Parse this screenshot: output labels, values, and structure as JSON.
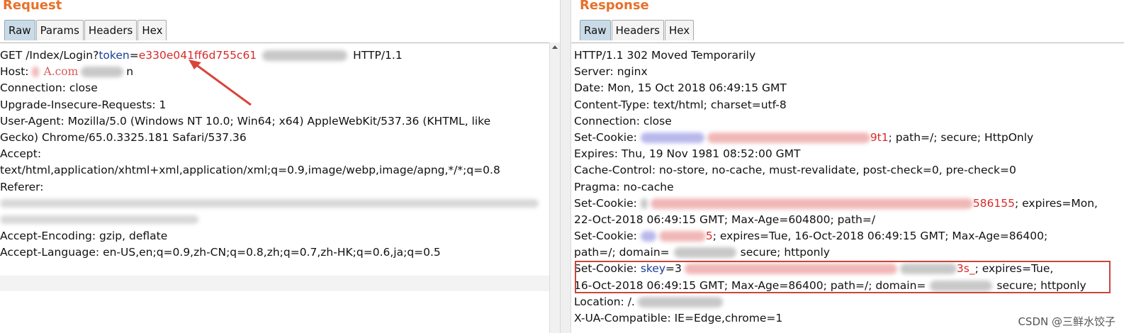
{
  "request": {
    "title": "Request",
    "tabs": [
      "Raw",
      "Params",
      "Headers",
      "Hex"
    ],
    "active_tab": "Raw",
    "lines": {
      "get_method": "GET /Index/Login?",
      "get_param": "token",
      "get_eq": "=",
      "get_value": "e330e041ff6d755c61",
      "get_tail": "HTTP/1.1",
      "host_label": "Host: ",
      "host_value": "A.com",
      "host_tail": "n",
      "connection": "Connection: close",
      "upgrade": "Upgrade-Insecure-Requests: 1",
      "ua1": "User-Agent: Mozilla/5.0 (Windows NT 10.0; Win64; x64) AppleWebKit/537.36 (KHTML, like",
      "ua2": "Gecko) Chrome/65.0.3325.181 Safari/537.36",
      "accept_label": "Accept:",
      "accept_value": "text/html,application/xhtml+xml,application/xml;q=0.9,image/webp,image/apng,*/*;q=0.8",
      "referer": "Referer:",
      "encoding": "Accept-Encoding: gzip, deflate",
      "language": "Accept-Language: en-US,en;q=0.9,zh-CN;q=0.8,zh;q=0.7,zh-HK;q=0.6,ja;q=0.5"
    }
  },
  "response": {
    "title": "Response",
    "tabs": [
      "Raw",
      "Headers",
      "Hex"
    ],
    "active_tab": "Raw",
    "lines": {
      "status": "HTTP/1.1 302 Moved Temporarily",
      "server": "Server: nginx",
      "date": "Date: Mon, 15 Oct 2018 06:49:15 GMT",
      "content_type": "Content-Type: text/html; charset=utf-8",
      "connection": "Connection: close",
      "cookie1_label": "Set-Cookie: ",
      "cookie1_frag": "9t1",
      "cookie1_tail": "; path=/; secure; HttpOnly",
      "expires": "Expires: Thu, 19 Nov 1981 08:52:00 GMT",
      "cache_control": "Cache-Control: no-store, no-cache, must-revalidate, post-check=0, pre-check=0",
      "pragma": "Pragma: no-cache",
      "cookie2_label": "Set-Cookie: ",
      "cookie2_frag": "586155",
      "cookie2_tail": "; expires=Mon,",
      "cookie2_line2": "22-Oct-2018 06:49:15 GMT; Max-Age=604800; path=/",
      "cookie3_label": "Set-Cookie: ",
      "cookie3_frag": "5",
      "cookie3_tail": "; expires=Tue, 16-Oct-2018 06:49:15 GMT; Max-Age=86400;",
      "cookie3_line2_a": "path=/; domain=",
      "cookie3_line2_b": "secure; httponly",
      "cookie4_label": "Set-Cookie: ",
      "cookie4_param": "skey",
      "cookie4_eq": "=3",
      "cookie4_frag": "3s_",
      "cookie4_tail": "; expires=Tue,",
      "cookie4_line2_a": "16-Oct-2018 06:49:15 GMT; Max-Age=86400; path=/; domain=",
      "cookie4_line2_b": "secure; httponly",
      "location": "Location: /.",
      "xua": "X-UA-Compatible: IE=Edge,chrome=1"
    }
  },
  "watermark": "CSDN @三鲜水饺子",
  "colors": {
    "title_orange": "#e8702a",
    "param_blue": "#1a3d9a",
    "value_red": "#d62a2a",
    "highlight_box": "#c9463b",
    "active_tab": "#c9dbe6"
  }
}
